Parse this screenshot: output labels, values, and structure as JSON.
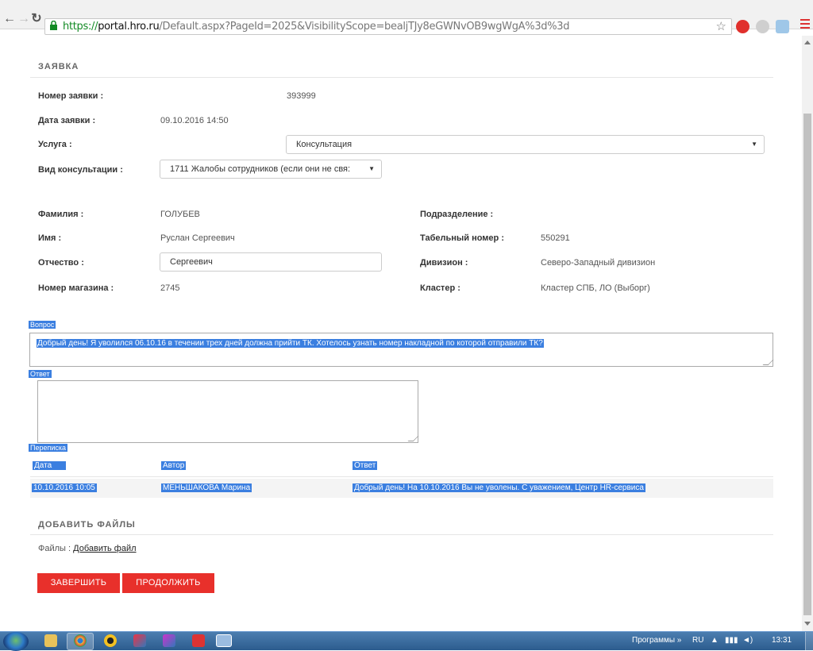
{
  "browser": {
    "url_scheme": "https://",
    "url_host": "portal.hro.ru",
    "url_path": "/Default.aspx?PageId=2025&VisibilityScope=bealjTJy8eGWNvOB9wgWgA%3d%3d"
  },
  "request": {
    "section_title": "ЗАЯВКА",
    "number_label": "Номер заявки :",
    "number_value": "393999",
    "date_label": "Дата заявки :",
    "date_value": "09.10.2016 14:50",
    "service_label": "Услуга :",
    "service_value": "Консультация",
    "consult_label": "Вид консультации :",
    "consult_value": "1711   Жалобы сотрудников (если они не свя:"
  },
  "person": {
    "surname_label": "Фамилия :",
    "surname_value": "ГОЛУБЕВ",
    "name_label": "Имя :",
    "name_value": "Руслан Сергеевич",
    "patronymic_label": "Отчество :",
    "patronymic_value": "Сергеевич",
    "store_label": "Номер магазина :",
    "store_value": "2745",
    "department_label": "Подразделение :",
    "department_value": "",
    "tabnum_label": "Табельный номер :",
    "tabnum_value": "550291",
    "division_label": "Дивизион :",
    "division_value": "Северо-Западный дивизион",
    "cluster_label": "Кластер :",
    "cluster_value": "Кластер СПБ, ЛО (Выборг)"
  },
  "question": {
    "label": "Вопрос",
    "text": "Добрый день! Я уволился 06.10.16 в течении трех дней должна прийти ТК. Хотелось узнать номер накладной по которой отправили ТК?"
  },
  "answer": {
    "label": "Ответ",
    "text": ""
  },
  "correspondence": {
    "label": "Переписка",
    "headers": [
      "Дата",
      "Автор",
      "Ответ"
    ],
    "rows": [
      {
        "date": "10.10.2016 10:05",
        "author": "МЕНЬШАКОВА Марина",
        "reply": "Добрый день!  На 10.10.2016 Вы не уволены.  С уважением,  Центр HR-сервиса"
      }
    ]
  },
  "files": {
    "section_title": "ДОБАВИТЬ ФАЙЛЫ",
    "label": "Файлы : ",
    "add_link": "Добавить файл"
  },
  "buttons": {
    "finish": "ЗАВЕРШИТЬ",
    "continue": "ПРОДОЛЖИТЬ"
  },
  "taskbar": {
    "programs": "Программы",
    "lang": "RU",
    "time": "13:31"
  },
  "colors": {
    "accent_red": "#e8302b",
    "selection_blue": "#3b7fe0"
  }
}
